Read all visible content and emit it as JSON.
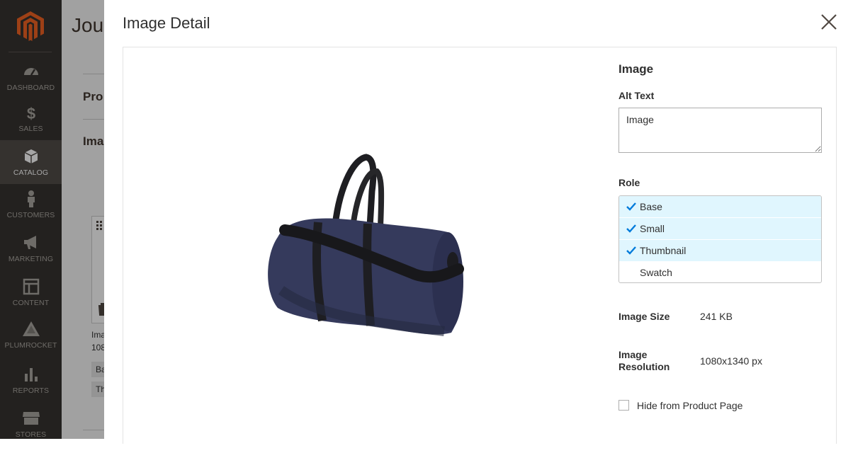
{
  "sidebar": {
    "items": [
      {
        "label": "DASHBOARD",
        "icon": "dashboard-icon"
      },
      {
        "label": "SALES",
        "icon": "dollar-icon"
      },
      {
        "label": "CATALOG",
        "icon": "box-icon",
        "active": true
      },
      {
        "label": "CUSTOMERS",
        "icon": "person-icon"
      },
      {
        "label": "MARKETING",
        "icon": "megaphone-icon"
      },
      {
        "label": "CONTENT",
        "icon": "layout-icon"
      },
      {
        "label": "PLUMROCKET",
        "icon": "plumrocket-icon"
      },
      {
        "label": "REPORTS",
        "icon": "bar-chart-icon"
      },
      {
        "label": "STORES",
        "icon": "store-icon"
      }
    ]
  },
  "background_page": {
    "title": "Jous",
    "sections": [
      "Pro",
      "Ima"
    ],
    "thumb_caption_1": "Ima",
    "thumb_caption_2": "108",
    "tags": [
      "Ba",
      "Th"
    ]
  },
  "modal": {
    "title": "Image Detail",
    "panel": {
      "heading": "Image",
      "alt_text_label": "Alt Text",
      "alt_text_value": "Image",
      "role_label": "Role",
      "roles": [
        {
          "label": "Base",
          "selected": true
        },
        {
          "label": "Small",
          "selected": true
        },
        {
          "label": "Thumbnail",
          "selected": true
        },
        {
          "label": "Swatch",
          "selected": false
        }
      ],
      "image_size_label": "Image Size",
      "image_size_value": "241 KB",
      "resolution_label_1": "Image",
      "resolution_label_2": "Resolution",
      "resolution_value": "1080x1340 px",
      "hide_label": "Hide from Product Page",
      "hide_checked": false
    }
  },
  "colors": {
    "sidebar_bg": "#373330",
    "sidebar_active": "#524d49",
    "logo": "#f26322",
    "role_selected_bg": "#e0f6fe",
    "check": "#007bdb"
  }
}
